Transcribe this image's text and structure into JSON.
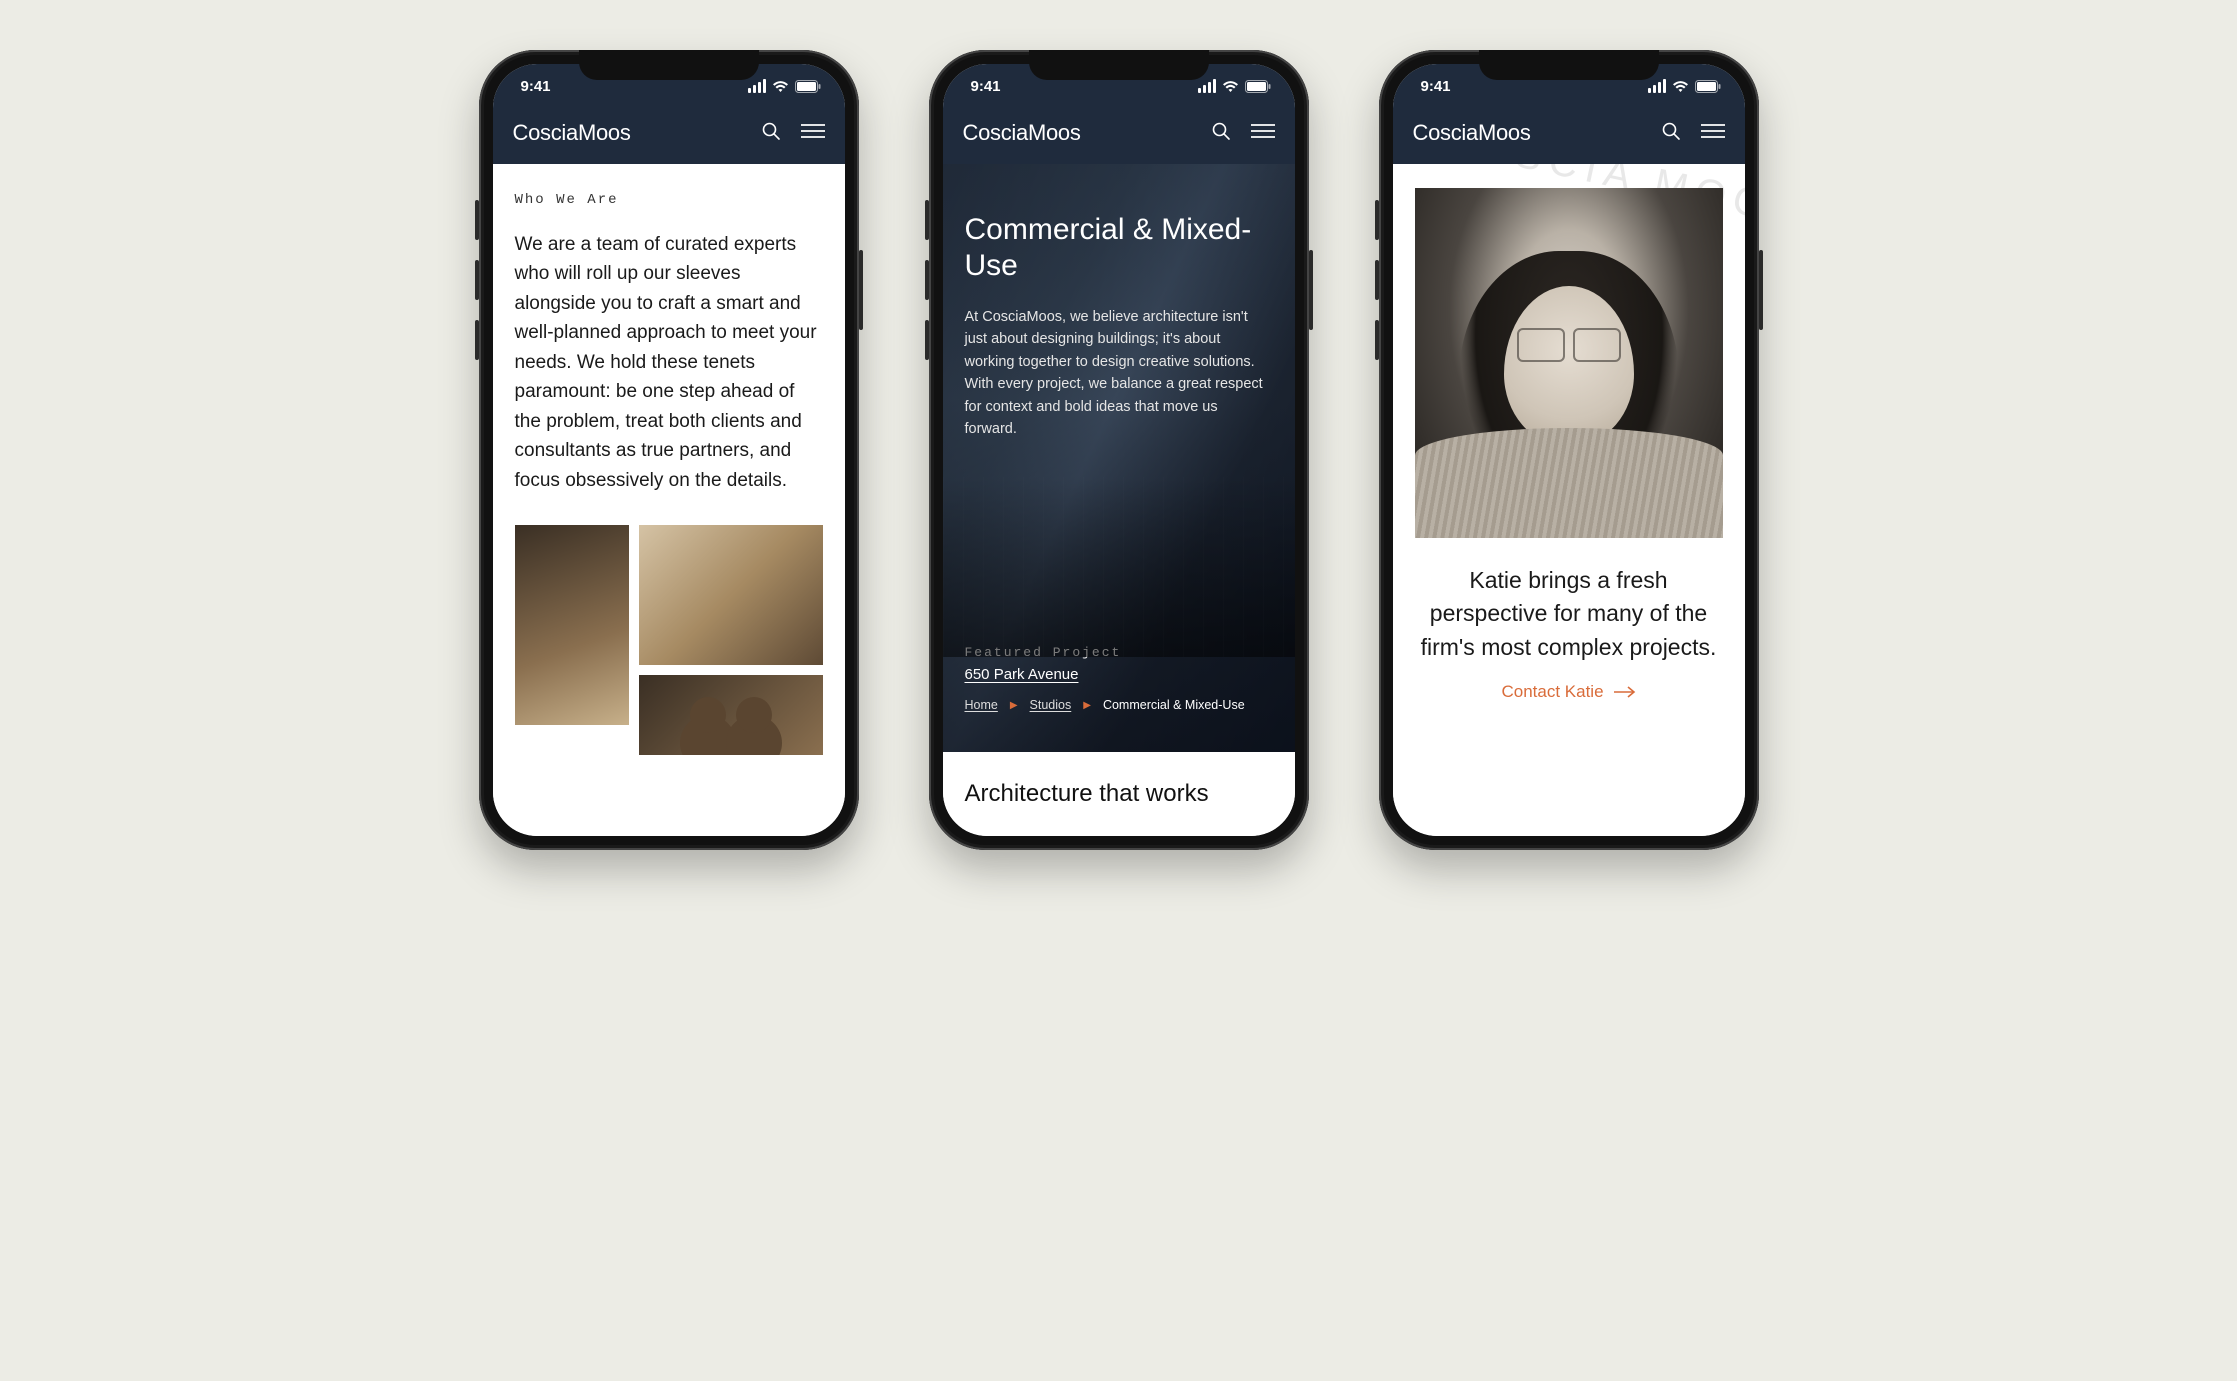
{
  "status": {
    "time": "9:41"
  },
  "brand": "CosciaMoos",
  "phone1": {
    "eyebrow": "Who We Are",
    "body": "We are a team of curated experts who will roll up our sleeves alongside you to craft a smart and well-planned approach to meet your needs. We hold these tenets paramount: be one step ahead of the problem, treat both clients and consultants as true partners, and focus obsessively on the details."
  },
  "phone2": {
    "title": "Commercial & Mixed-Use",
    "body": "At CosciaMoos, we believe architecture isn't just about designing buildings; it's about working together to design creative solutions. With every project, we balance a great respect for context and bold ideas that move us forward.",
    "featured_label": "Featured Project",
    "featured_link": "650 Park Avenue",
    "breadcrumb": {
      "home": "Home",
      "studios": "Studios",
      "current": "Commercial & Mixed-Use"
    },
    "section_heading": "Architecture that works"
  },
  "phone3": {
    "watermark": "OSCIA MOQ",
    "bio": "Katie brings a fresh perspective for many of the firm's most complex projects.",
    "cta": "Contact Katie"
  },
  "colors": {
    "navy": "#1f2b3d",
    "accent": "#d96c3a",
    "page_bg": "#ecece5"
  }
}
